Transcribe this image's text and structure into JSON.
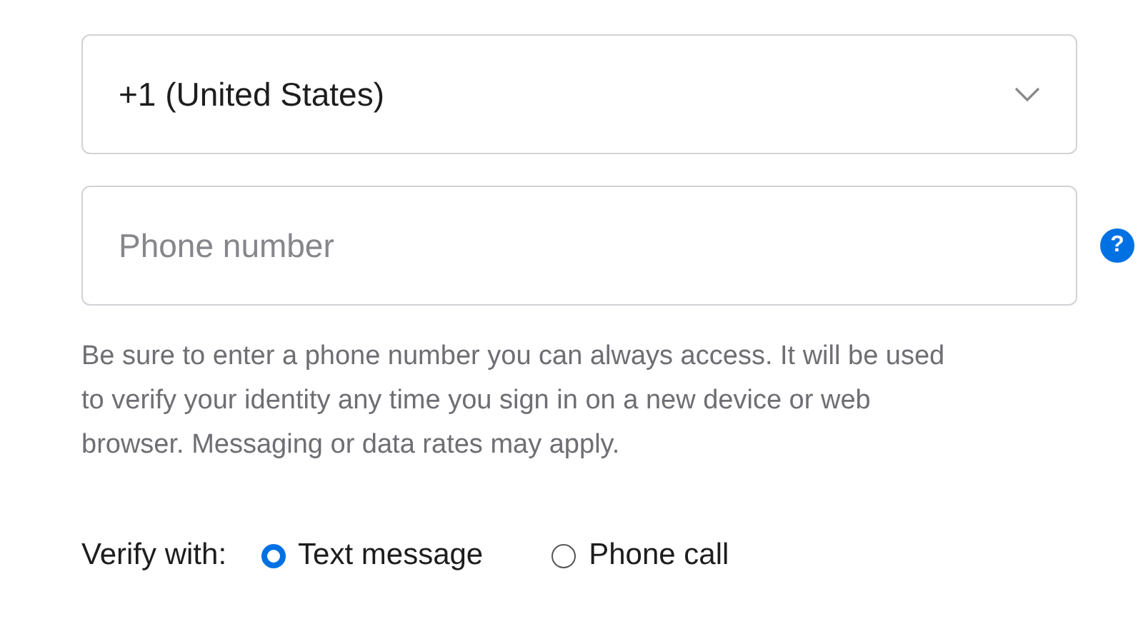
{
  "country_select": {
    "value": "+1 (United States)"
  },
  "phone_field": {
    "placeholder": "Phone number"
  },
  "help": {
    "glyph": "?"
  },
  "hint": "Be sure to enter a phone number you can always access. It will be used to verify your identity any time you sign in on a new device or web browser. Messaging or data rates may apply.",
  "verify": {
    "label": "Verify with:",
    "options": [
      {
        "label": "Text message",
        "selected": true
      },
      {
        "label": "Phone call",
        "selected": false
      }
    ]
  }
}
